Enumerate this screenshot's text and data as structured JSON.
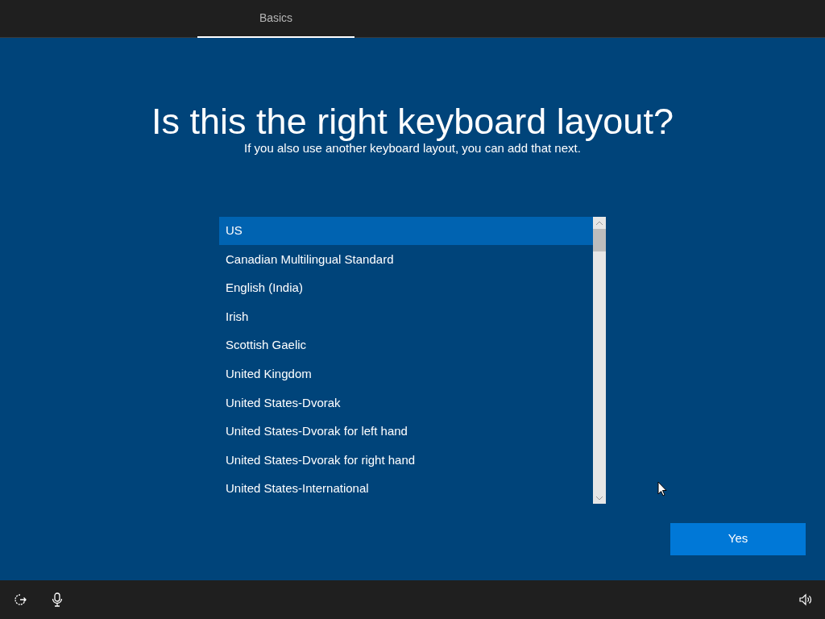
{
  "tabs": [
    {
      "label": "Basics",
      "selected": true
    }
  ],
  "heading": "Is this the right keyboard layout?",
  "subheading": "If you also use another keyboard layout, you can add that next.",
  "layouts": [
    {
      "label": "US",
      "selected": true
    },
    {
      "label": "Canadian Multilingual Standard",
      "selected": false
    },
    {
      "label": "English (India)",
      "selected": false
    },
    {
      "label": "Irish",
      "selected": false
    },
    {
      "label": "Scottish Gaelic",
      "selected": false
    },
    {
      "label": "United Kingdom",
      "selected": false
    },
    {
      "label": "United States-Dvorak",
      "selected": false
    },
    {
      "label": "United States-Dvorak for left hand",
      "selected": false
    },
    {
      "label": "United States-Dvorak for right hand",
      "selected": false
    },
    {
      "label": "United States-International",
      "selected": false
    }
  ],
  "buttons": [
    "Yes"
  ]
}
